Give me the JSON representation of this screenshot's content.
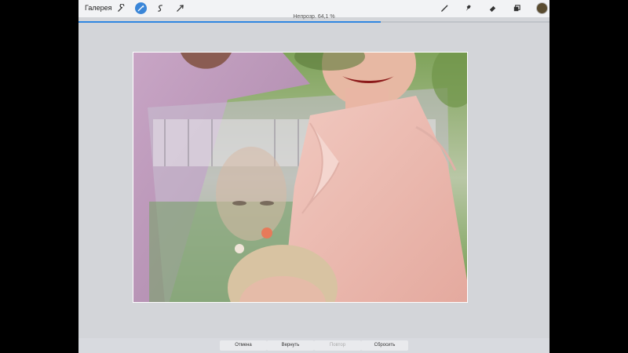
{
  "topbar": {
    "gallery_label": "Галерея",
    "left_tools": [
      {
        "icon": "wrench-icon",
        "active": false
      },
      {
        "icon": "magic-wand-icon",
        "active": true
      },
      {
        "icon": "selection-icon",
        "active": false
      },
      {
        "icon": "transform-arrow-icon",
        "active": false
      }
    ],
    "right_tools": [
      {
        "icon": "brush-icon"
      },
      {
        "icon": "smudge-icon"
      },
      {
        "icon": "eraser-icon"
      },
      {
        "icon": "layers-icon"
      }
    ],
    "color_swatch": "#5a4c30"
  },
  "adjustment": {
    "label": "Непрозр. 64,1 %",
    "opacity_fraction": 0.641,
    "accent": "#2f86e0"
  },
  "bottom": {
    "undo_label": "Отмена",
    "redo_label": "Вернуть",
    "repeat_label": "Повтор",
    "reset_label": "Сбросить"
  }
}
